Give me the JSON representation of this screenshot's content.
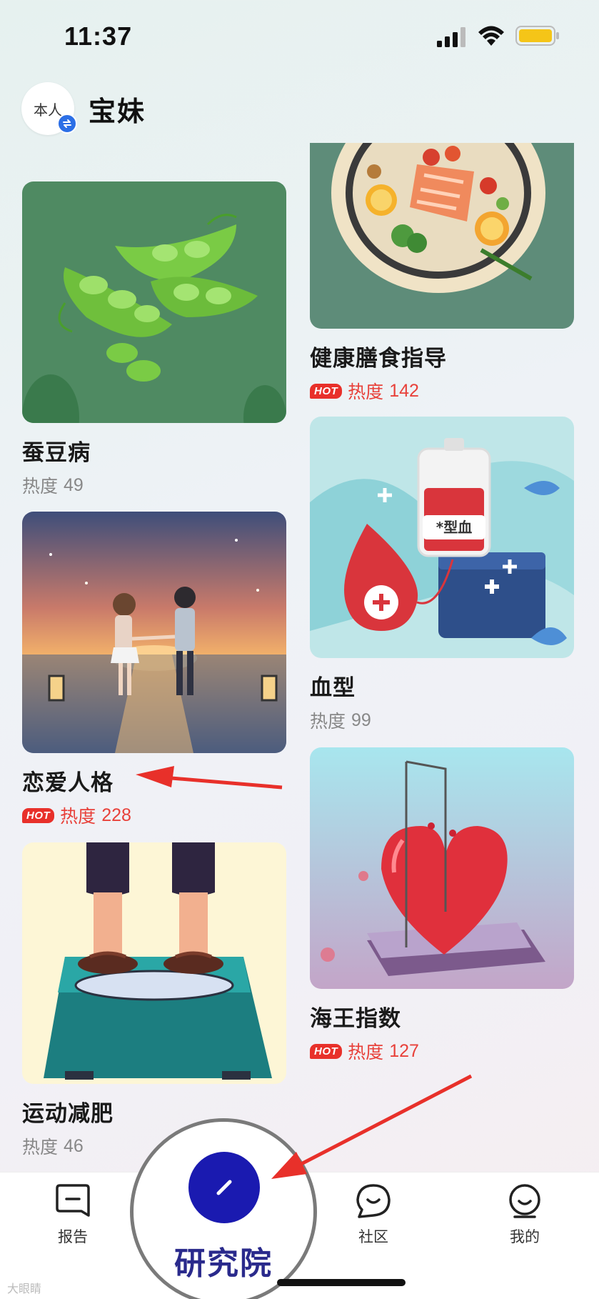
{
  "status_bar": {
    "time": "11:37"
  },
  "header": {
    "avatar_label": "本人",
    "profile_name": "宝妹"
  },
  "cards": {
    "diet": {
      "title": "健康膳食指导",
      "hot_badge": "HOT",
      "heat_label": "热度",
      "heat_value": "142",
      "hot": true
    },
    "favism": {
      "title": "蚕豆病",
      "heat_label": "热度",
      "heat_value": "49",
      "hot": false
    },
    "blood": {
      "title": "血型",
      "heat_label": "热度",
      "heat_value": "99",
      "hot": false,
      "image_text": "*型血"
    },
    "love": {
      "title": "恋爱人格",
      "hot_badge": "HOT",
      "heat_label": "热度",
      "heat_value": "228",
      "hot": true
    },
    "seaking": {
      "title": "海王指数",
      "hot_badge": "HOT",
      "heat_label": "热度",
      "heat_value": "127",
      "hot": true
    },
    "fitness": {
      "title": "运动减肥",
      "heat_label": "热度",
      "heat_value": "46",
      "hot": false
    }
  },
  "tab_bar": {
    "report": "报告",
    "institute": "研究院",
    "community": "社区",
    "mine": "我的"
  },
  "watermark": "大眼睛",
  "colors": {
    "hot": "#e8413a",
    "center_button": "#1a1ab0",
    "accent": "#2c6fe6"
  }
}
